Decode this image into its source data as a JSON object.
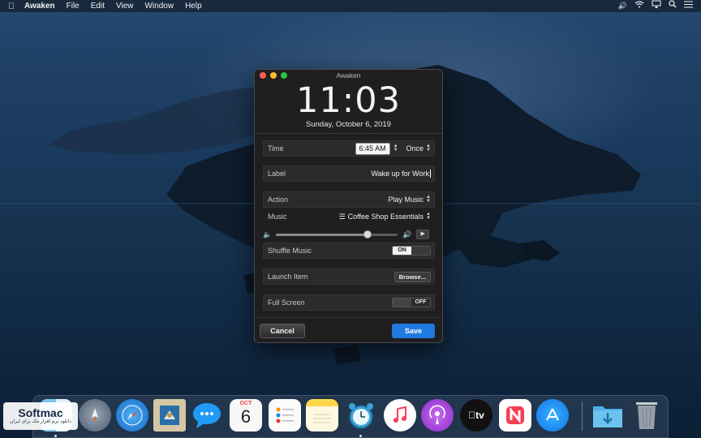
{
  "menubar": {
    "app_name": "Awaken",
    "menus": [
      "File",
      "Edit",
      "View",
      "Window",
      "Help"
    ],
    "apple_icon": "apple-icon",
    "status_icons": [
      "volume-icon",
      "wifi-icon",
      "airplay-icon",
      "search-icon",
      "list-icon"
    ]
  },
  "window": {
    "title": "Awaken",
    "clock": "11:03",
    "date": "Sunday, October 6, 2019",
    "time_row": {
      "label": "Time",
      "value": "6:45 AM",
      "repeat": "Once"
    },
    "label_row": {
      "label": "Label",
      "value": "Wake up for Work"
    },
    "action_row": {
      "label": "Action",
      "value": "Play Music"
    },
    "music_row": {
      "label": "Music",
      "value": "Coffee Shop Essentials"
    },
    "volume": {
      "level": 0.75
    },
    "shuffle_row": {
      "label": "Shuffle Music",
      "toggle": "ON"
    },
    "launch_row": {
      "label": "Launch Item",
      "button": "Browse..."
    },
    "fullscreen_row": {
      "label": "Full Screen",
      "toggle": "OFF"
    },
    "cancel_label": "Cancel",
    "save_label": "Save",
    "colors": {
      "accent": "#1f7ae0",
      "close": "#fe5f57",
      "minimize": "#febc2e",
      "maximize": "#28c840"
    }
  },
  "dock": {
    "calendar": {
      "month": "OCT",
      "day": "6"
    },
    "apps": [
      "finder-icon",
      "launchpad-icon",
      "safari-icon",
      "mail-icon",
      "messages-icon",
      "calendar-icon",
      "reminders-icon",
      "notes-icon",
      "awaken-icon",
      "music-icon",
      "podcasts-icon",
      "tv-icon",
      "news-icon",
      "app-store-icon",
      "downloads-folder-icon",
      "trash-icon"
    ],
    "tv_label": "tv"
  },
  "watermark": {
    "main": "Softmac",
    "sub": "دانلود نرم افزار مک برای ایران"
  }
}
